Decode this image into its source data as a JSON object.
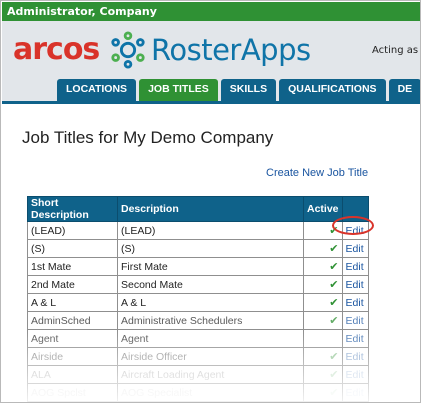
{
  "topbar": {
    "user_label": "Administrator, Company"
  },
  "header": {
    "logo_brand": "arcos",
    "logo_product": "RosterApps",
    "acting_text": "Acting as"
  },
  "tabs": [
    {
      "label": "LOCATIONS",
      "active": false
    },
    {
      "label": "JOB TITLES",
      "active": true
    },
    {
      "label": "SKILLS",
      "active": false
    },
    {
      "label": "QUALIFICATIONS",
      "active": false
    },
    {
      "label": "DE",
      "active": false
    }
  ],
  "page": {
    "title": "Job Titles for My Demo Company",
    "create_link": "Create New Job Title"
  },
  "table": {
    "headers": [
      "Short Description",
      "Description",
      "Active",
      ""
    ],
    "rows": [
      {
        "short": "(LEAD)",
        "desc": "(LEAD)",
        "active": "✔",
        "edit": "Edit"
      },
      {
        "short": "(S)",
        "desc": "(S)",
        "active": "✔",
        "edit": "Edit"
      },
      {
        "short": "1st Mate",
        "desc": "First Mate",
        "active": "✔",
        "edit": "Edit"
      },
      {
        "short": "2nd Mate",
        "desc": "Second Mate",
        "active": "✔",
        "edit": "Edit"
      },
      {
        "short": "A & L",
        "desc": "A & L",
        "active": "✔",
        "edit": "Edit"
      },
      {
        "short": "AdminSched",
        "desc": "Administrative Schedulers",
        "active": "✔",
        "edit": "Edit"
      },
      {
        "short": "Agent",
        "desc": "Agent",
        "active": "",
        "edit": "Edit"
      },
      {
        "short": "Airside",
        "desc": "Airside Officer",
        "active": "✔",
        "edit": "Edit"
      },
      {
        "short": "ALA",
        "desc": "Aircraft Loading Agent",
        "active": "✔",
        "edit": "Edit"
      },
      {
        "short": "AOG Spclst",
        "desc": "AOG Specialist",
        "active": "✔",
        "edit": "Edit"
      }
    ]
  },
  "colors": {
    "green": "#2f9134",
    "blue": "#0f628a",
    "red": "#d9332a"
  }
}
